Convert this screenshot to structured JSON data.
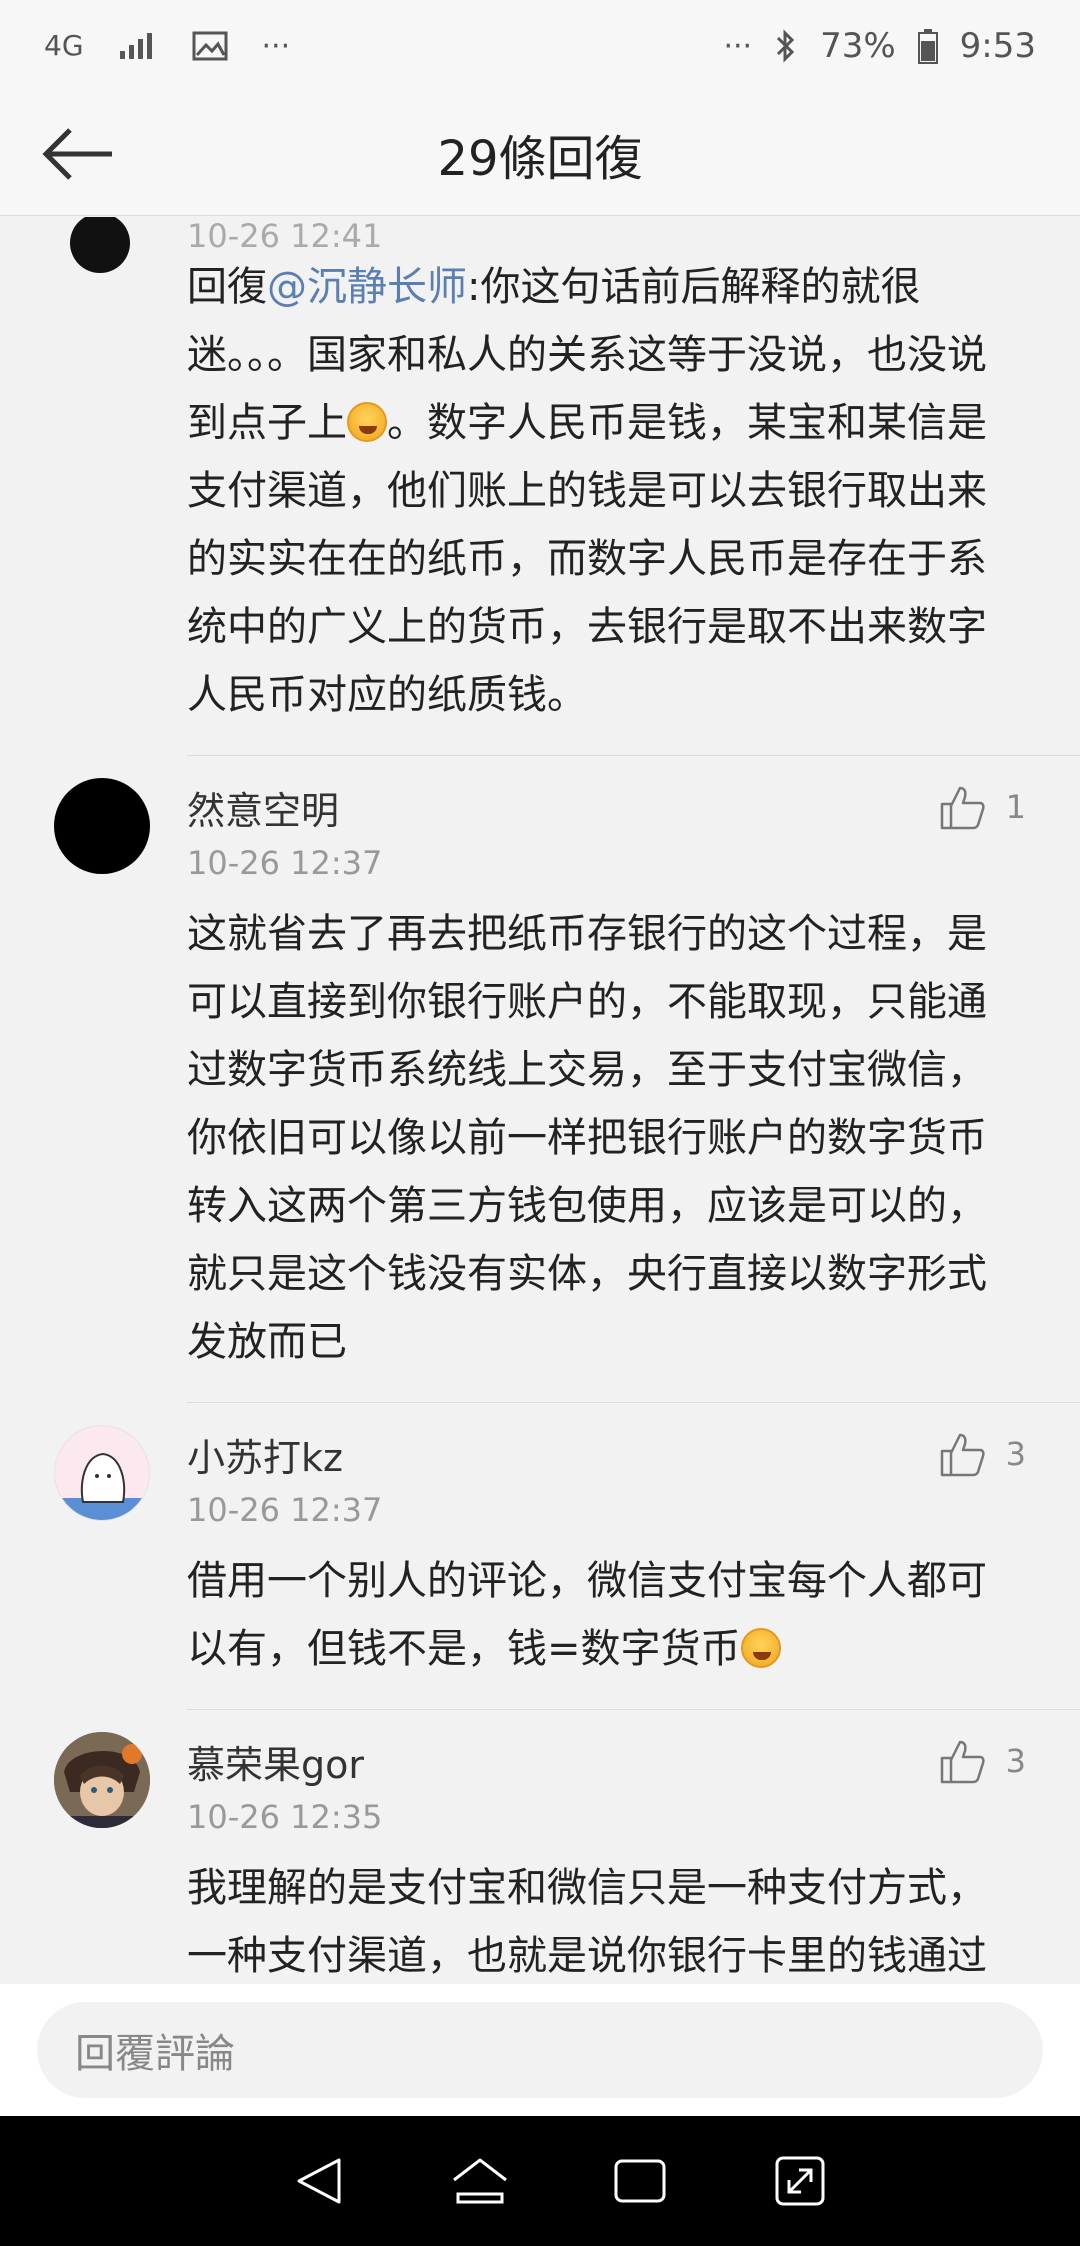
{
  "status_bar": {
    "network": "4G",
    "more_icon": "more-dots",
    "bluetooth_icon": "bluetooth",
    "battery_percent": "73%",
    "time": "9:53"
  },
  "nav": {
    "title": "29條回復"
  },
  "first_comment": {
    "timestamp": "10-26 12:41",
    "prefix": "回復",
    "mention": "@沉静长师",
    "text_a": ":你这句话前后解释的就很迷。。。国家和私人的关系这等于没说，也没说到点子上",
    "text_b": "。数字人民币是钱，某宝和某信是支付渠道，他们账上的钱是可以去银行取出来的实实在在的纸币，而数字人民币是存在于系统中的广义上的货币，去银行是取不出来数字人民币对应的纸质钱。"
  },
  "comments": [
    {
      "name": "然意空明",
      "likes": "1",
      "time": "10-26 12:37",
      "text": "这就省去了再去把纸币存银行的这个过程，是可以直接到你银行账户的，不能取现，只能通过数字货币系统线上交易，至于支付宝微信，你依旧可以像以前一样把银行账户的数字货币转入这两个第三方钱包使用，应该是可以的，就只是这个钱没有实体，央行直接以数字形式发放而已"
    },
    {
      "name": "小苏打kz",
      "likes": "3",
      "time": "10-26 12:37",
      "text": "借用一个别人的评论，微信支付宝每个人都可以有，但钱不是，钱=数字货币"
    },
    {
      "name": "慕荣果gor",
      "likes": "3",
      "time": "10-26 12:35",
      "text": "我理解的是支付宝和微信只是一种支付方式，一种支付渠道，也就是说你银行卡里的钱通过"
    }
  ],
  "reply_bar": {
    "placeholder": "回覆評論"
  },
  "colors": {
    "mention": "#5b7fb0",
    "background": "#f2f2f2"
  }
}
